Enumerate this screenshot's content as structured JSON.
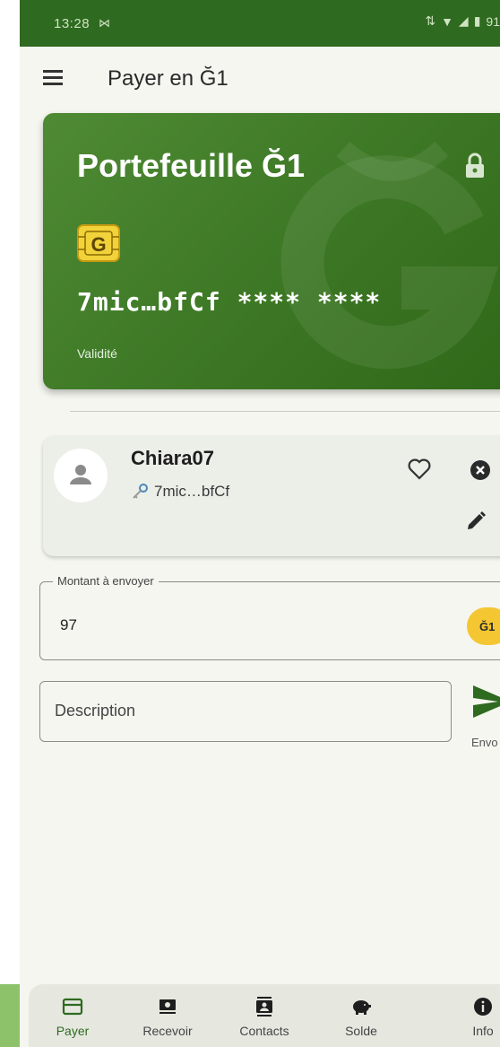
{
  "status_bar": {
    "time": "13:28",
    "mail_indicator": "⋈",
    "icons": [
      "vpn-icon",
      "wifi-icon",
      "signal-icon",
      "battery-icon"
    ],
    "battery": "91"
  },
  "app_bar": {
    "title": "Payer en Ğ1"
  },
  "wallet": {
    "title": "Portefeuille Ğ1",
    "chip_letter": "G",
    "number": "7mic…bfCf **** ****",
    "validity_label": "Validité",
    "colors": {
      "card_start": "#4f8a34",
      "card_end": "#2f6818"
    }
  },
  "recipient": {
    "name": "Chiara07",
    "key": "7mic…bfCf"
  },
  "amount": {
    "label": "Montant à envoyer",
    "value": "97",
    "currency": "Ğ1"
  },
  "description": {
    "placeholder": "Description"
  },
  "send": {
    "label": "Envo"
  },
  "nav": {
    "items": [
      {
        "label": "Payer",
        "icon": "card-icon",
        "active": true
      },
      {
        "label": "Recevoir",
        "icon": "cash-icon",
        "active": false
      },
      {
        "label": "Contacts",
        "icon": "contacts-icon",
        "active": false
      },
      {
        "label": "Solde",
        "icon": "piggy-bank-icon",
        "active": false
      },
      {
        "label": "Info",
        "icon": "info-icon",
        "active": false
      }
    ]
  },
  "colors": {
    "primary": "#2e6a1f",
    "accent": "#f4c632",
    "background": "#f5f6f0"
  }
}
